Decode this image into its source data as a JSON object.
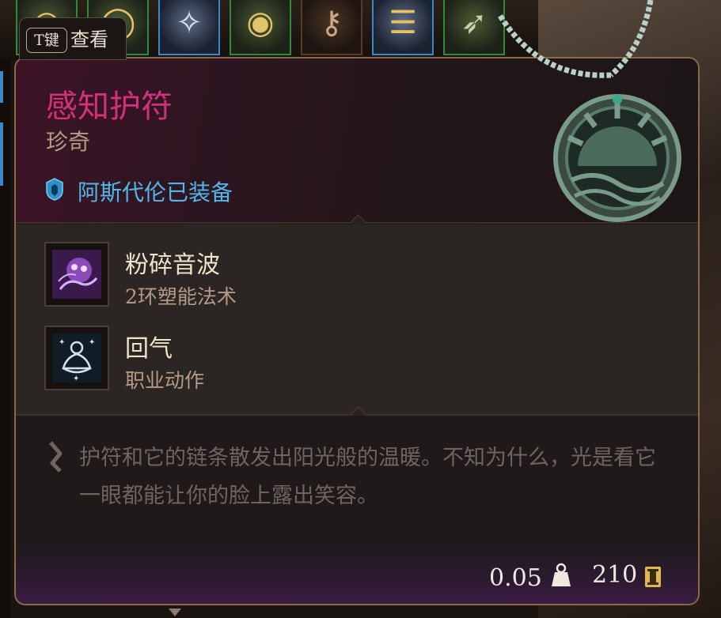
{
  "inventory": {
    "slots": [
      {
        "icon": "ring-icon",
        "rarity": "rare"
      },
      {
        "icon": "ring-icon",
        "rarity": "rare"
      },
      {
        "icon": "scroll-icon",
        "rarity": "blue"
      },
      {
        "icon": "ring-icon",
        "rarity": "rare"
      },
      {
        "icon": "key-icon",
        "rarity": "plain"
      },
      {
        "icon": "scroll-icon",
        "rarity": "blue"
      },
      {
        "icon": "arrow-icon",
        "rarity": "rare"
      }
    ]
  },
  "keyhint": {
    "key": "T键",
    "label": "查看"
  },
  "item": {
    "name": "感知护符",
    "rarity": "珍奇",
    "equipped_by": "阿斯代伦已装备",
    "actions": [
      {
        "name": "粉碎音波",
        "type": "2环塑能法术",
        "icon": "shatter-spell-icon"
      },
      {
        "name": "回气",
        "type": "职业动作",
        "icon": "meditation-icon"
      }
    ],
    "description": "护符和它的链条散发出阳光般的温暖。不知为什么，光是看它一眼都能让你的脸上露出笑容。",
    "weight": "0.05",
    "value": "210"
  },
  "colors": {
    "rarity_title": "#d4307a",
    "equipped": "#4fb8e8",
    "rare_border": "#2f8a3a",
    "blue_border": "#3d86c8"
  }
}
